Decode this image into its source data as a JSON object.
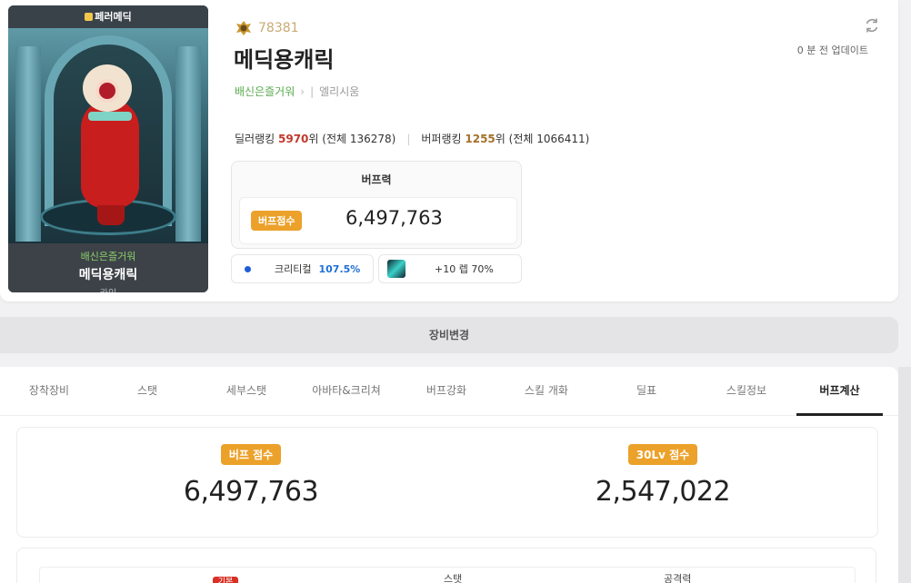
{
  "character": {
    "card_label": "페러메딕",
    "guild": "배신은즐거워",
    "name": "메딕용캐릭",
    "job": "카인",
    "level": "78381",
    "update_text": "0 분 전 업데이트",
    "world": "엘리시움"
  },
  "rank": {
    "dealer_label": "딜러랭킹",
    "dealer_rank": "5970",
    "dealer_suffix": "위 (전체 136278)",
    "buffer_label": "버퍼랭킹",
    "buffer_rank": "1255",
    "buffer_suffix": "위 (전체 1066411)"
  },
  "buff": {
    "title": "버프력",
    "badge": "버프점수",
    "value": "6,497,763",
    "crit_label": "크리티컬",
    "crit_value": "107.5%",
    "weapon_text": "+10 렙 70%"
  },
  "equip_change": "장비변경",
  "tabs": [
    "장착장비",
    "스탯",
    "세부스탯",
    "아바타&크리쳐",
    "버프강화",
    "스킬 개화",
    "딜표",
    "스킬정보",
    "버프계산"
  ],
  "active_tab": "버프계산",
  "scores": {
    "buff_label": "버프 점수",
    "buff_value": "6,497,763",
    "lv30_label": "30Lv 점수",
    "lv30_value": "2,547,022"
  },
  "stat_table": {
    "tag": "기본",
    "col_stat": "스탯",
    "col_attack": "공격력"
  },
  "colors": {
    "accent_orange": "#eca12a",
    "rank_red": "#c0392b",
    "crit_blue": "#1f6fd6",
    "guild_green": "#5aaa4e"
  }
}
